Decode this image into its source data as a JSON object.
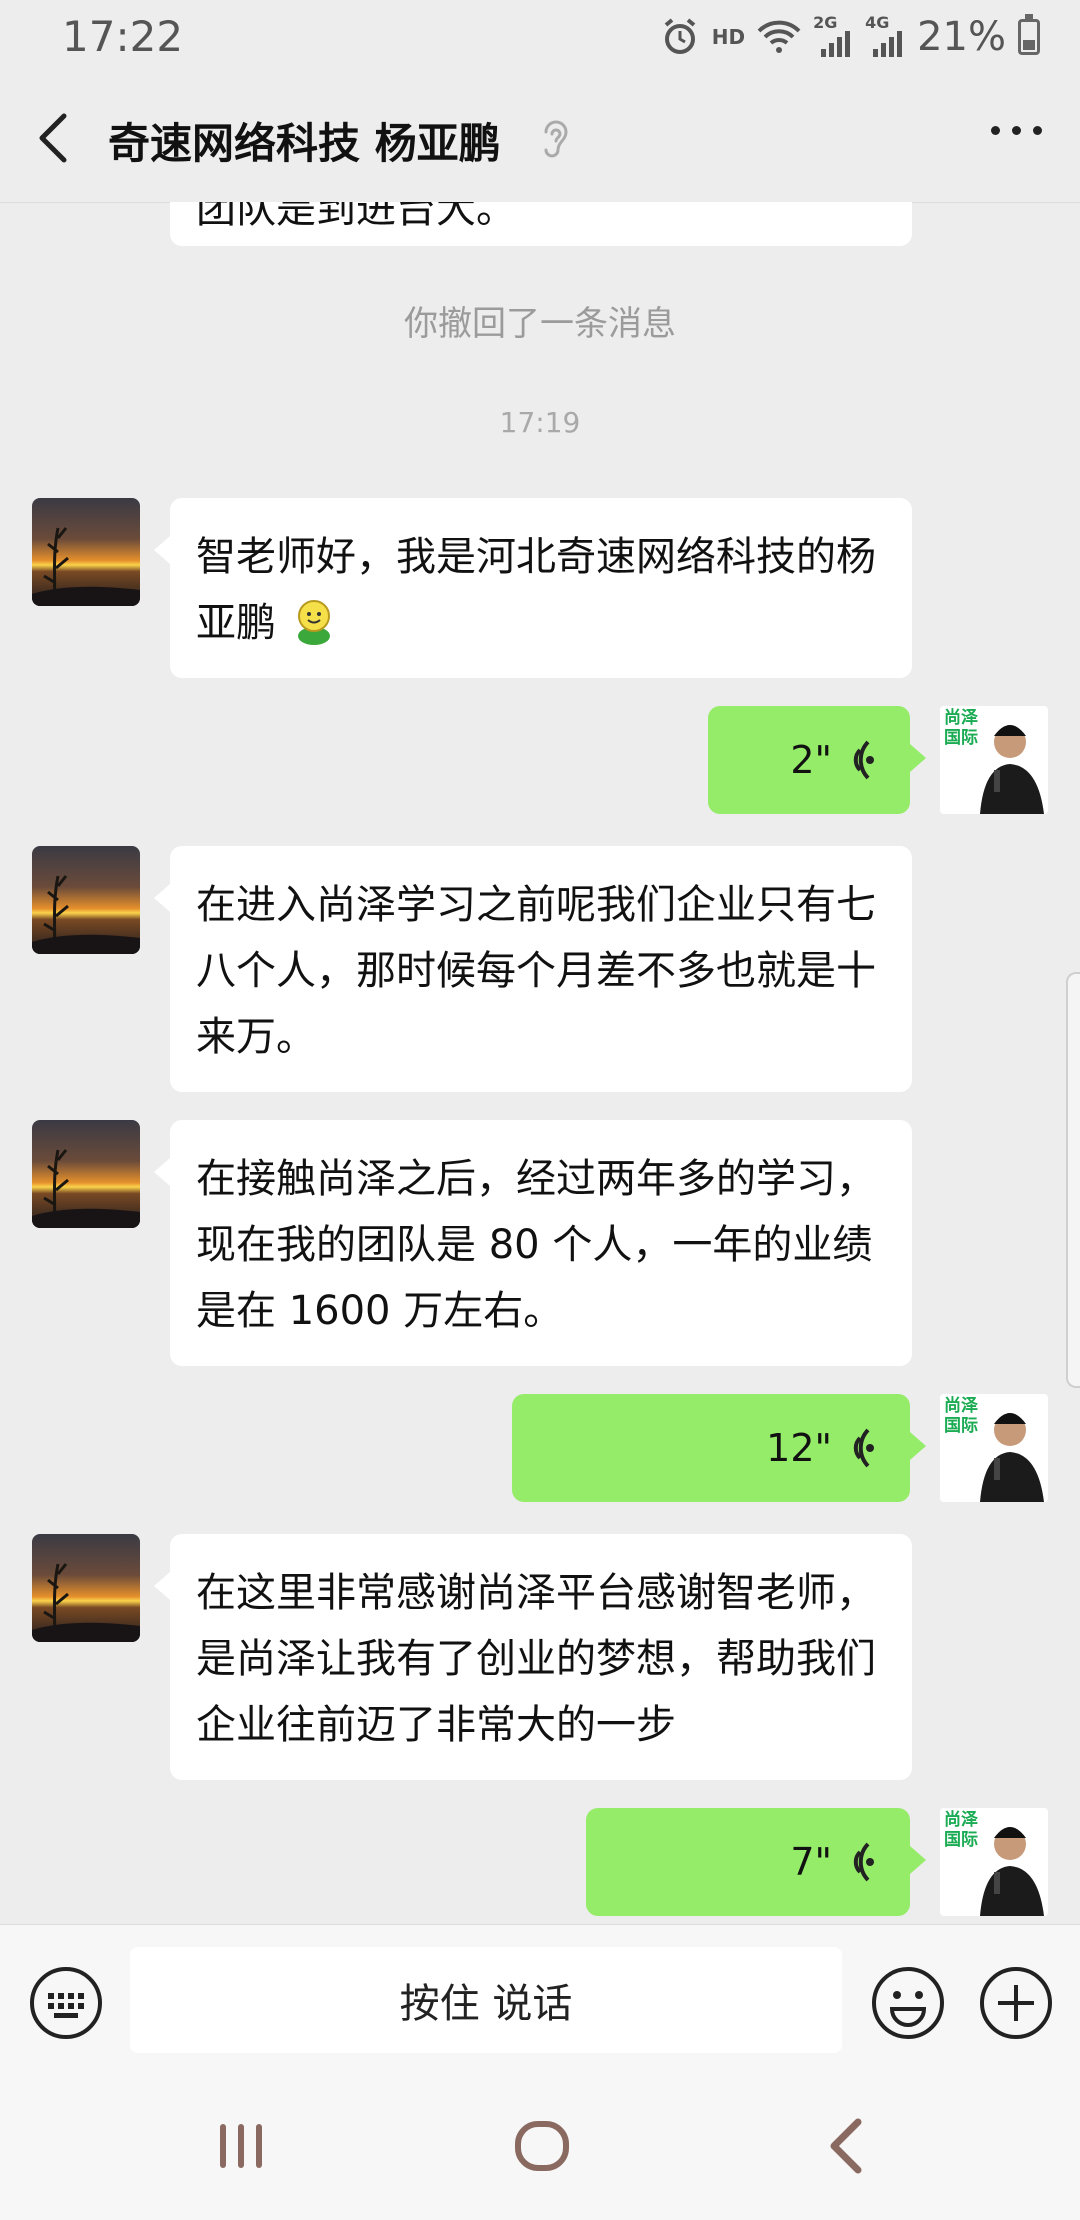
{
  "status": {
    "time": "17:22",
    "hd": "HD",
    "net_2g": "2G",
    "net_4g": "4G",
    "battery": "21%"
  },
  "header": {
    "title": "奇速网络科技  杨亚鹏",
    "icons": [
      "back-arrow-icon",
      "ear-icon",
      "more-icon"
    ]
  },
  "chat": {
    "partial_top_text": "团队是到进台大。",
    "recall_notice": "你撤回了一条消息",
    "timestamp": "17:19",
    "messages": [
      {
        "side": "left",
        "type": "text",
        "text": "智老师好，我是河北奇速网络科技的杨亚鹏",
        "emoji": "smile-icon"
      },
      {
        "side": "right",
        "type": "voice",
        "duration": "2\""
      },
      {
        "side": "left",
        "type": "text",
        "text": "在进入尚泽学习之前呢我们企业只有七八个人，那时候每个月差不多也就是十来万。"
      },
      {
        "side": "left",
        "type": "text",
        "text": "在接触尚泽之后，经过两年多的学习，现在我的团队是 80 个人，一年的业绩是在 1600 万左右。"
      },
      {
        "side": "right",
        "type": "voice",
        "duration": "12\""
      },
      {
        "side": "left",
        "type": "text",
        "text": "在这里非常感谢尚泽平台感谢智老师，是尚泽让我有了创业的梦想，帮助我们企业往前迈了非常大的一步"
      },
      {
        "side": "right",
        "type": "voice",
        "duration": "7\""
      }
    ],
    "avatar_badge": [
      "尚泽",
      "国际"
    ]
  },
  "input": {
    "hold_to_talk": "按住 说话"
  },
  "colors": {
    "sent_bubble": "#95ec69",
    "received_bubble": "#ffffff",
    "background": "#ededed",
    "badge_green": "#1aab53"
  }
}
